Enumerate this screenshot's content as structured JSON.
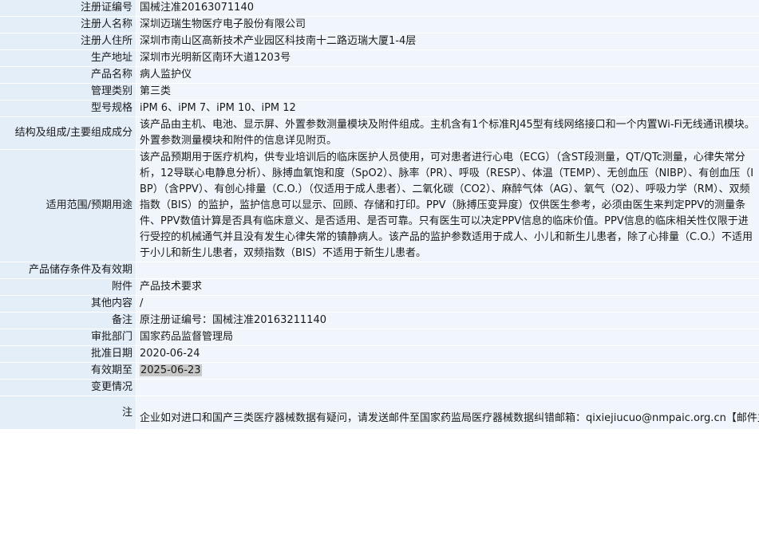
{
  "rows": {
    "reg_no": {
      "label": "注册证编号",
      "value": "国械注准20163071140"
    },
    "registrant_name": {
      "label": "注册人名称",
      "value": "深圳迈瑞生物医疗电子股份有限公司"
    },
    "registrant_address": {
      "label": "注册人住所",
      "value": "深圳市南山区高新技术产业园区科技南十二路迈瑞大厦1-4层"
    },
    "production_address": {
      "label": "生产地址",
      "value": "深圳市光明新区南环大道1203号"
    },
    "product_name": {
      "label": "产品名称",
      "value": "病人监护仪"
    },
    "management_class": {
      "label": "管理类别",
      "value": "第三类"
    },
    "model_spec": {
      "label": "型号规格",
      "value": "iPM 6、iPM 7、iPM 10、iPM 12"
    },
    "structure": {
      "label": "结构及组成/主要组成成分",
      "value": "该产品由主机、电池、显示屏、外置参数测量模块及附件组成。主机含有1个标准RJ45型有线网络接口和一个内置Wi-Fi无线通讯模块。外置参数测量模块和附件的信息详见附页。"
    },
    "scope": {
      "label": "适用范围/预期用途",
      "value": "该产品预期用于医疗机构，供专业培训后的临床医护人员使用，可对患者进行心电（ECG）（含ST段测量，QT/QTc测量，心律失常分析，12导联心电静息分析）、脉搏血氧饱和度（SpO2）、脉率（PR）、呼吸（RESP）、体温（TEMP）、无创血压（NIBP）、有创血压（IBP）（含PPV）、有创心排量（C.O.）（仅适用于成人患者）、二氧化碳（CO2）、麻醉气体（AG）、氧气（O2）、呼吸力学（RM）、双频指数（BIS）的监护，监护信息可以显示、回顾、存储和打印。PPV（脉搏压变异度）仅供医生参考，必须由医生来判定PPV的测量条件、PPV数值计算是否具有临床意义、是否适用、是否可靠。只有医生可以决定PPV信息的临床价值。PPV信息的临床相关性仅限于进行受控的机械通气并且没有发生心律失常的镇静病人。该产品的监护参数适用于成人、小儿和新生儿患者，除了心排量（C.O.）不适用于小儿和新生儿患者，双频指数（BIS）不适用于新生儿患者。"
    },
    "storage": {
      "label": "产品储存条件及有效期",
      "value": ""
    },
    "attachment": {
      "label": "附件",
      "value": "产品技术要求"
    },
    "other": {
      "label": "其他内容",
      "value": "/"
    },
    "remark": {
      "label": "备注",
      "value": "原注册证编号：国械注准20163211140"
    },
    "approval_dept": {
      "label": "审批部门",
      "value": "国家药品监督管理局"
    },
    "approval_date": {
      "label": "批准日期",
      "value": "2020-06-24"
    },
    "expiry_date": {
      "label": "有效期至",
      "value": "2025-06-23"
    },
    "change": {
      "label": "变更情况",
      "value": ""
    },
    "note": {
      "label": "注",
      "value": "企业如对进口和国产三类医疗器械数据有疑问，请发送邮件至国家药监局医疗器械数据纠错邮箱：qixiejiucuo@nmpaic.org.cn【邮件主题请注明“医疗器械数据问题”，邮件正文中请准确填写以下全部信息：1.医疗器械注册证号/备案号；2.类型（注册、变更、延续等）；3.问题描述（500字以内）；4.企业名称（全称）；5.统一社会信用代码；6.联系人姓名；7.联系电话（手机和座机）；8.联系邮箱】，或致电国家药监局医疗器械数据纠错电话010-88331514（此电话为我局医疗器械数据纠错联系电话，并非相应产品/企业业务咨询电话）。企业如对国产一类和二类医疗器械数据有疑问，请咨询国家局信息中心，电话010-88332877，88331520（工作日），也可通过发邮件与我们联系：邮件地址yaopinshuju@nmpaic.org.cn，邮件主题请注明“国产医疗器械产品（注册）-数据（注册证号/备案号）数据问题”。国产一类和二类医疗器械数据来源于省局，由省局通过数据共享平台进行纠错和维护。"
    }
  },
  "colors": {
    "label_bg": "#e3eef9",
    "value_bg": "#f1f6fc",
    "highlight": "#c8c8c8"
  }
}
